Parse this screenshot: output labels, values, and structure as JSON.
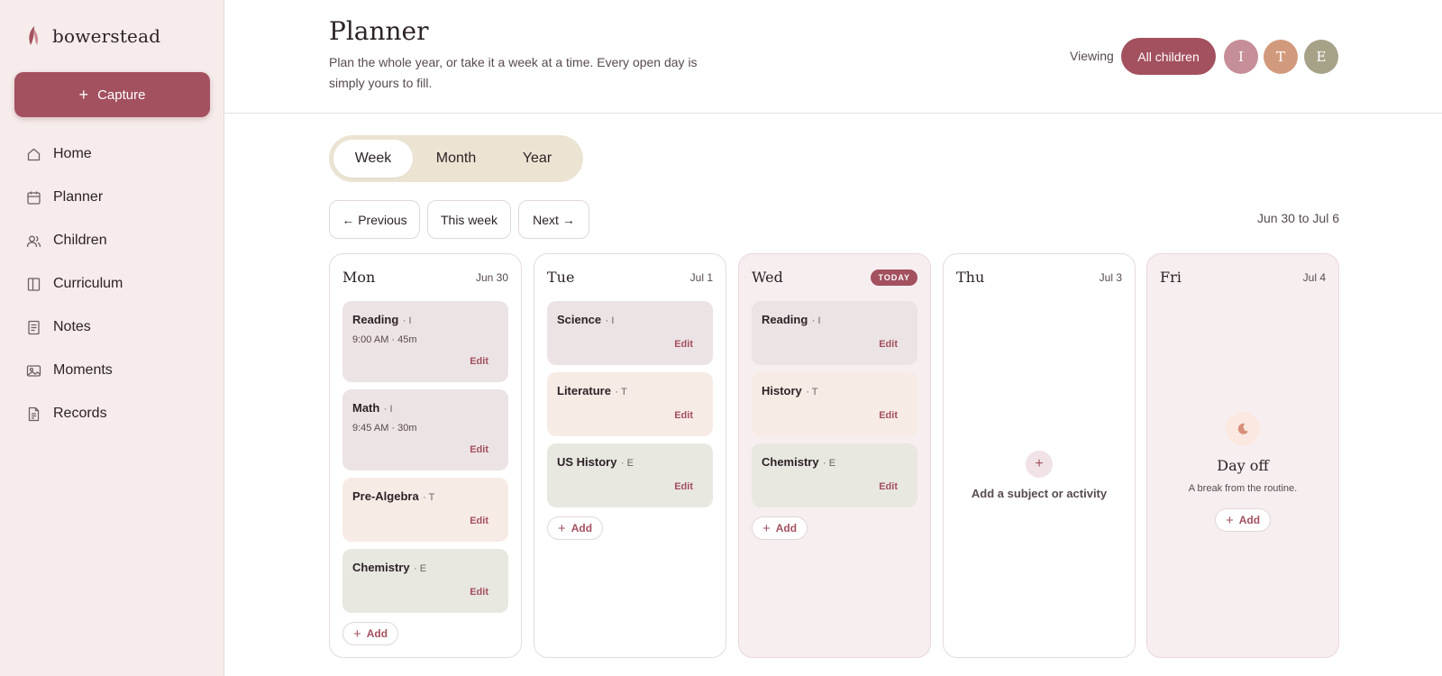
{
  "brand": {
    "name": "bowerstead"
  },
  "sidebar": {
    "capture_label": "Capture",
    "items": [
      {
        "label": "Home",
        "icon": "home-icon"
      },
      {
        "label": "Planner",
        "icon": "calendar-icon"
      },
      {
        "label": "Children",
        "icon": "users-icon"
      },
      {
        "label": "Curriculum",
        "icon": "book-icon"
      },
      {
        "label": "Notes",
        "icon": "notes-icon"
      },
      {
        "label": "Moments",
        "icon": "image-icon"
      },
      {
        "label": "Records",
        "icon": "document-icon"
      }
    ]
  },
  "header": {
    "title": "Planner",
    "subtitle": "Plan the whole year, or take it a week at a time. Every open day is simply yours to fill.",
    "viewing_label": "Viewing",
    "filter_label": "All children",
    "avatars": [
      "I",
      "T",
      "E"
    ]
  },
  "views": {
    "week": "Week",
    "month": "Month",
    "year": "Year",
    "active": "Week"
  },
  "week_nav": {
    "previous": "← Previous",
    "this_week": "This week",
    "next": "Next →",
    "range": "Jun 30 to Jul 6"
  },
  "days": [
    {
      "name": "Mon",
      "date": "Jun 30",
      "items": [
        {
          "subject": "Reading",
          "kid": "· I",
          "meta": "9:00 AM · 45m",
          "edit": "Edit",
          "tone": "pink"
        },
        {
          "subject": "Math",
          "kid": "· I",
          "meta": "9:45 AM · 30m",
          "edit": "Edit",
          "tone": "pink"
        },
        {
          "subject": "Pre-Algebra",
          "kid": "· T",
          "edit": "Edit",
          "tone": "peach"
        },
        {
          "subject": "Chemistry",
          "kid": "· E",
          "edit": "Edit",
          "tone": "sage"
        }
      ],
      "add_label": "Add"
    },
    {
      "name": "Tue",
      "date": "Jul 1",
      "items": [
        {
          "subject": "Science",
          "kid": "· I",
          "edit": "Edit",
          "tone": "pink"
        },
        {
          "subject": "Literature",
          "kid": "· T",
          "edit": "Edit",
          "tone": "peach"
        },
        {
          "subject": "US History",
          "kid": "· E",
          "edit": "Edit",
          "tone": "sage"
        }
      ],
      "add_label": "Add"
    },
    {
      "name": "Wed",
      "badge": "TODAY",
      "items": [
        {
          "subject": "Reading",
          "kid": "· I",
          "edit": "Edit",
          "tone": "pink"
        },
        {
          "subject": "History",
          "kid": "· T",
          "edit": "Edit",
          "tone": "peach"
        },
        {
          "subject": "Chemistry",
          "kid": "· E",
          "edit": "Edit",
          "tone": "sage"
        }
      ],
      "add_label": "Add"
    },
    {
      "name": "Thu",
      "date": "Jul 3",
      "empty_label": "Add a subject or activity"
    },
    {
      "name": "Fri",
      "date": "Jul 4",
      "off_title": "Day off",
      "off_sub": "A break from the routine.",
      "add_label": "Add"
    }
  ],
  "colors": {
    "accent": "#a3505f",
    "sidebar_bg": "#f6eceb",
    "card_pink": "#ece3e4",
    "card_peach": "#f7ebe6",
    "card_sage": "#e8e7e0",
    "toggle_bg": "#ece4d3"
  }
}
